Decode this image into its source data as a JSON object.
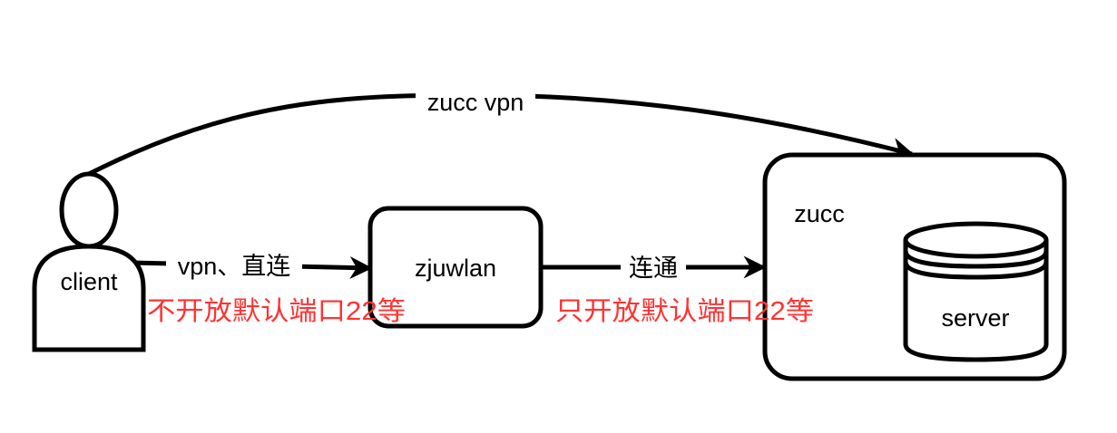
{
  "nodes": {
    "client": {
      "label": "client"
    },
    "zjuwlan": {
      "label": "zjuwlan"
    },
    "zucc": {
      "label": "zucc"
    },
    "server": {
      "label": "server"
    }
  },
  "edges": {
    "client_to_zucc": {
      "label": "zucc vpn"
    },
    "client_to_zjuwlan": {
      "label": "vpn、直连",
      "note": "不开放默认端口22等"
    },
    "zjuwlan_to_zucc": {
      "label": "连通",
      "note": "只开放默认端口22等"
    }
  },
  "colors": {
    "stroke": "#000000",
    "note_text": "#ff3333",
    "background": "#ffffff"
  }
}
